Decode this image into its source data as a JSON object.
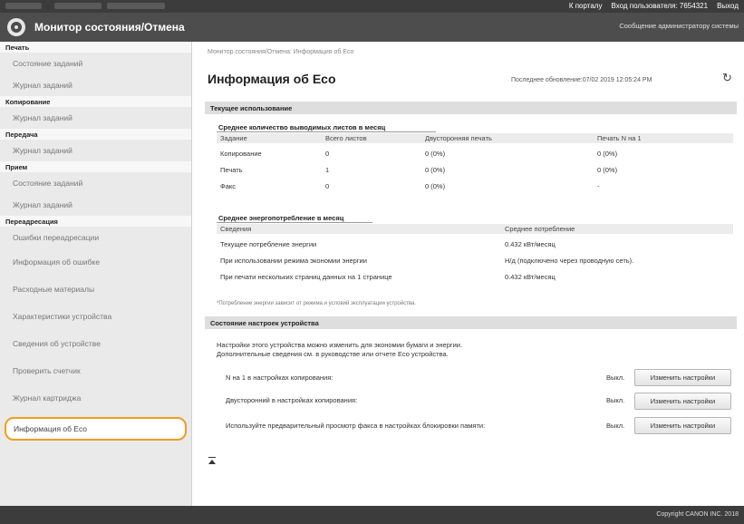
{
  "topbar": {
    "portal_link": "К порталу",
    "login_label": "Вход пользователя: 7654321",
    "logout_link": "Выход"
  },
  "header": {
    "title": "Монитор состояния/Отмена",
    "admin_message": "Сообщение администратору системы"
  },
  "sidebar": {
    "sections": [
      {
        "category": "Печать",
        "items": [
          "Состояние заданий",
          "Журнал заданий"
        ]
      },
      {
        "category": "Копирование",
        "items": [
          "Журнал заданий"
        ]
      },
      {
        "category": "Передача",
        "items": [
          "Журнал заданий"
        ]
      },
      {
        "category": "Прием",
        "items": [
          "Состояние заданий",
          "Журнал заданий"
        ]
      },
      {
        "category": "Переадресация",
        "items": [
          "Ошибки переадресации"
        ]
      }
    ],
    "other_items": [
      "Информация об ошибке",
      "Расходные материалы",
      "Характеристики устройства",
      "Сведения об устройстве",
      "Проверить счетчик",
      "Журнал картриджа",
      "Информация об Eco"
    ],
    "highlight_color": "#f29c1f"
  },
  "main": {
    "breadcrumb": "Монитор состояния/Отмена: Информация об Eco",
    "page_title": "Информация об Eco",
    "last_update": "Последнее обновление:07/02 2019 12:05:24 PM",
    "refresh_icon": "refresh-icon",
    "current_usage": {
      "title": "Текущее использование",
      "sheets": {
        "title": "Среднее количество выводимых листов в месяц",
        "headers": [
          "Задание",
          "Всего листов",
          "Двусторонняя печать",
          "Печать N на 1"
        ],
        "rows": [
          [
            "Копирование",
            "0",
            "0 (0%)",
            "0 (0%)"
          ],
          [
            "Печать",
            "1",
            "0 (0%)",
            "0 (0%)"
          ],
          [
            "Факс",
            "0",
            "0 (0%)",
            "-"
          ]
        ]
      },
      "energy": {
        "title": "Среднее энергопотребление в месяц",
        "headers": [
          "Сведения",
          "Среднее потребление"
        ],
        "rows": [
          [
            "Текущее потребление энергии",
            "0.432 кВт/месяц"
          ],
          [
            "При использовании режима экономии энергии",
            "Н/д (подключено через проводную сеть)."
          ],
          [
            "При печати нескольких страниц данных на 1 странице",
            "0.432 кВт/месяц"
          ]
        ],
        "note": "*Потребление энергии зависит от режима и условий эксплуатации устройства."
      }
    },
    "device_settings": {
      "title": "Состояние настроек устройства",
      "description_line1": "Настройки этого устройства можно изменить для экономии бумаги и энергии.",
      "description_line2": "Дополнительные сведения см. в руководстве или отчете Eco устройства.",
      "rows": [
        {
          "label": "N на 1 в настройках копирования:",
          "status": "Выкл.",
          "button": "Изменить настройки"
        },
        {
          "label": "Двусторонний в настройках копирования:",
          "status": "Выкл.",
          "button": "Изменить настройки"
        },
        {
          "label": "Используйте предварительный просмотр факса в настройках блокировки памяти:",
          "status": "Выкл.",
          "button": "Изменить настройки"
        }
      ]
    },
    "to_top_icon": "to-top-icon"
  },
  "footer": {
    "copyright": "Copyright CANON INC. 2018"
  }
}
